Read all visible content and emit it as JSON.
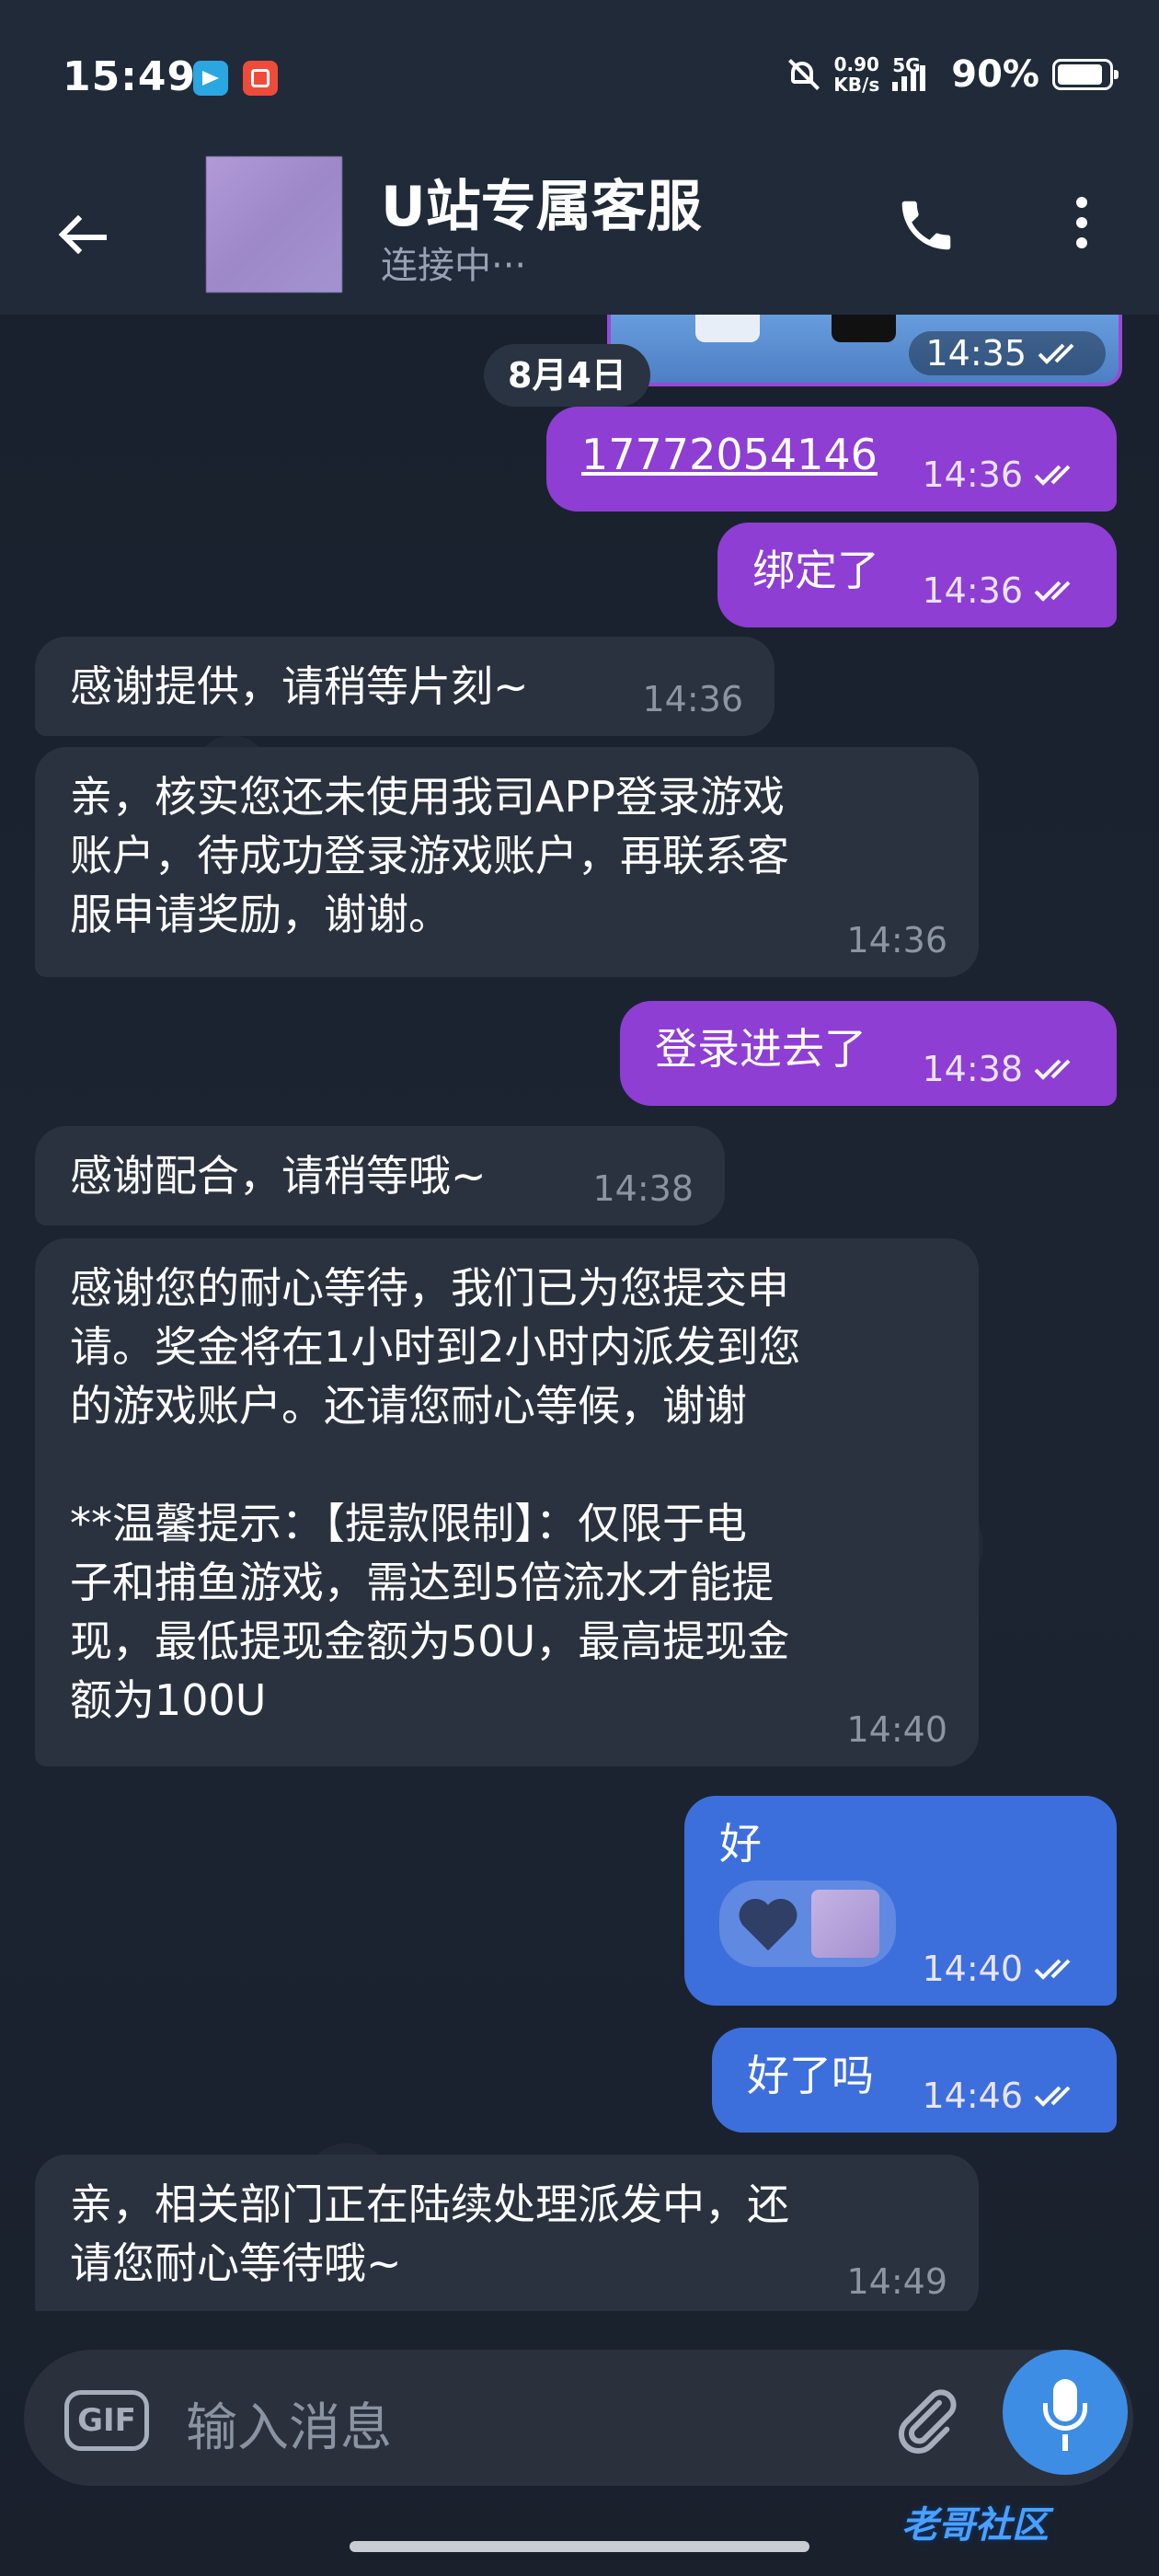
{
  "status_bar": {
    "time": "15:49",
    "net_speed_value": "0.90",
    "net_speed_unit": "KB/s",
    "network": "5G",
    "battery": "90%"
  },
  "header": {
    "title": "U站专属客服",
    "subtitle": "连接中···"
  },
  "chat": {
    "prev_image_time": "14:35",
    "date": "8月4日",
    "messages": [
      {
        "dir": "out",
        "text": "17772054146",
        "time": "14:36"
      },
      {
        "dir": "out",
        "text": "绑定了",
        "time": "14:36"
      },
      {
        "dir": "in",
        "text": "感谢提供，请稍等片刻~",
        "time": "14:36"
      },
      {
        "dir": "in",
        "text": "亲，核实您还未使用我司APP登录游戏\n账户，待成功登录游戏账户，再联系客\n服申请奖励，谢谢。",
        "time": "14:36"
      },
      {
        "dir": "out",
        "text": "登录进去了",
        "time": "14:38"
      },
      {
        "dir": "in",
        "text": "感谢配合，请稍等哦~",
        "time": "14:38"
      },
      {
        "dir": "in",
        "text": "感谢您的耐心等待，我们已为您提交申\n请。奖金将在1小时到2小时内派发到您\n的游戏账户。还请您耐心等候，谢谢\n\n**温馨提示：【提款限制】：仅限于电\n子和捕鱼游戏，需达到5倍流水才能提\n现，最低提现金额为50U，最高提现金\n额为100U",
        "time": "14:40"
      },
      {
        "dir": "out",
        "text": "好",
        "time": "14:40"
      },
      {
        "dir": "out",
        "text": "好了吗",
        "time": "14:46"
      },
      {
        "dir": "in",
        "text": "亲，相关部门正在陆续处理派发中，还\n请您耐心等待哦~",
        "time": "14:49"
      }
    ]
  },
  "input": {
    "gif_label": "GIF",
    "placeholder": "输入消息"
  },
  "watermark": "老哥社区",
  "colors": {
    "outgoing_purple": "#8e3ed3",
    "outgoing_blue": "#3d6fdc",
    "incoming": "#2b323f",
    "mic_button": "#3e8de4"
  }
}
